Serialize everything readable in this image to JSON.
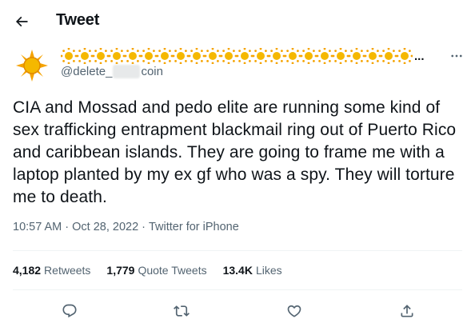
{
  "header": {
    "title": "Tweet",
    "back_icon": "arrow-left-icon"
  },
  "author": {
    "display_name_suffix": "...",
    "handle_prefix": "@delete_",
    "handle_suffix": "coin",
    "avatar_icon": "sun-icon"
  },
  "tweet": {
    "text": "CIA and Mossad and pedo elite are running some kind of sex trafficking entrapment blackmail ring out of Puerto Rico and caribbean islands. They are going to frame me with a laptop planted by my ex gf who was a spy. They will torture me to death.",
    "time": "10:57 AM",
    "sep1": "·",
    "date": "Oct 28, 2022",
    "sep2": "·",
    "source": "Twitter for iPhone"
  },
  "stats": {
    "retweets_count": "4,182",
    "retweets_label": "Retweets",
    "quotes_count": "1,779",
    "quotes_label": "Quote Tweets",
    "likes_count": "13.4K",
    "likes_label": "Likes"
  },
  "actions": [
    "reply-icon",
    "retweet-icon",
    "like-icon",
    "share-icon"
  ],
  "colors": {
    "text": "#0f1419",
    "secondary": "#536471",
    "divider": "#eff3f4",
    "sun": "#f5b800"
  }
}
